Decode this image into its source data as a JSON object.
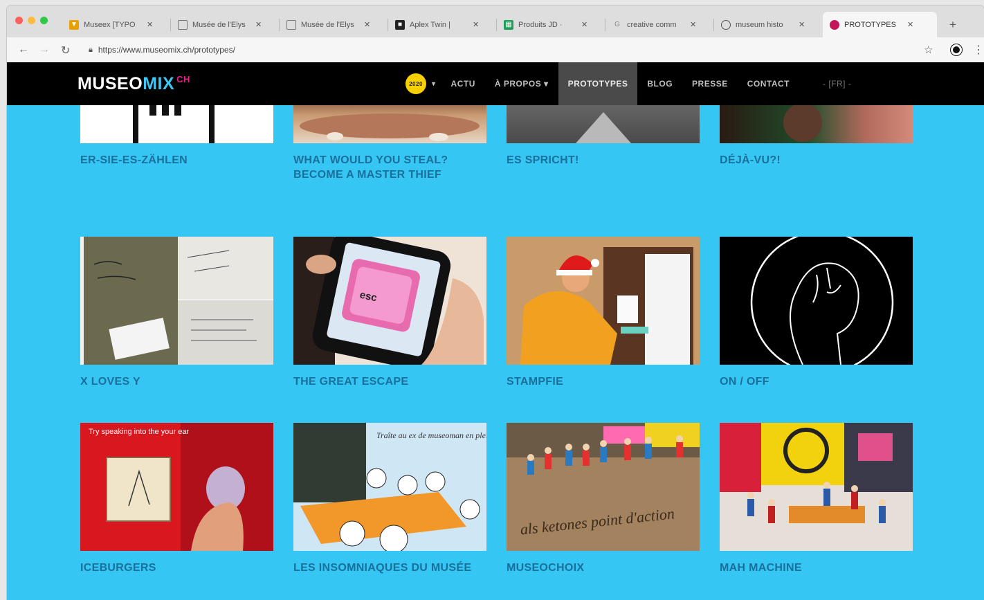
{
  "browser": {
    "tabs": [
      {
        "title": "Museex [TYPO",
        "icon": "vue-icon",
        "color": "#e8a200"
      },
      {
        "title": "Musée de l'Elys",
        "icon": "document-icon",
        "color": "#777777"
      },
      {
        "title": "Musée de l'Elys",
        "icon": "document-icon",
        "color": "#777777"
      },
      {
        "title": "Aplex Twin |",
        "icon": "app-icon",
        "color": "#222222"
      },
      {
        "title": "Produits JD ·",
        "icon": "sheet-icon",
        "color": "#1e9d58"
      },
      {
        "title": "creative comm",
        "icon": "cc-icon",
        "color": "#888888"
      },
      {
        "title": "museum histo",
        "icon": "globe-icon",
        "color": "#555555"
      },
      {
        "title": "PROTOTYPES",
        "icon": "site-icon",
        "color": "#c2185b",
        "active": true
      }
    ],
    "url": "https://www.museomix.ch/prototypes/"
  },
  "site": {
    "logo": {
      "part1": "MUSEO",
      "part2": "MIX",
      "part3": "CH"
    },
    "badge": "2020",
    "nav": [
      {
        "label": "ACTU"
      },
      {
        "label": "À PROPOS ▾"
      },
      {
        "label": "PROTOTYPES",
        "active": true
      },
      {
        "label": "BLOG"
      },
      {
        "label": "PRESSE"
      },
      {
        "label": "CONTACT"
      },
      {
        "label": "- [FR] -"
      }
    ],
    "prototypes": [
      {
        "title": "ER-SIE-ES-ZÄHLEN"
      },
      {
        "title": "WHAT WOULD YOU STEAL? BECOME A MASTER THIEF"
      },
      {
        "title": "ES SPRICHT!"
      },
      {
        "title": "DÉJÀ-VU?!"
      },
      {
        "title": "X LOVES Y"
      },
      {
        "title": "THE GREAT ESCAPE",
        "image_text": "esc"
      },
      {
        "title": "STAMPFIE"
      },
      {
        "title": "ON / OFF"
      },
      {
        "title": "ICEBURGERS",
        "image_text": "Try speaking into the your ear"
      },
      {
        "title": "LES INSOMNIAQUES DU MUSÉE",
        "image_text": "Traîte au ex de museoman en plein Beauf !!!"
      },
      {
        "title": "MUSEOCHOIX",
        "image_text": "als ketones point d'action"
      },
      {
        "title": "MAH MACHINE"
      }
    ]
  },
  "colors": {
    "page_bg": "#35c6f4",
    "title_color": "#1b6f9b",
    "header_bg": "#000000",
    "accent_pink": "#e91d8c"
  }
}
